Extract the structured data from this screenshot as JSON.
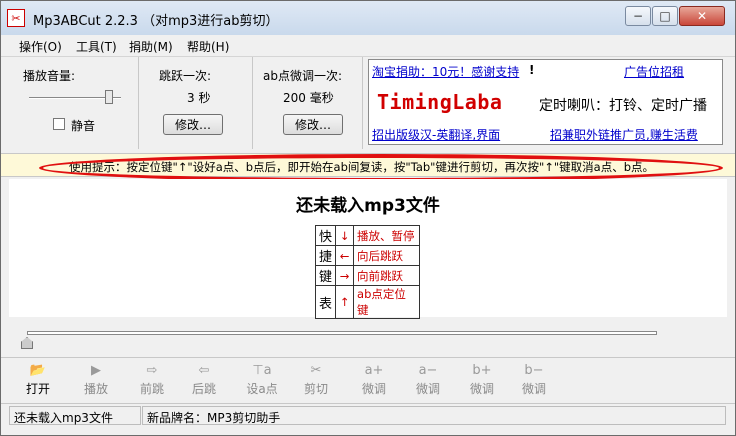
{
  "window": {
    "title": "Mp3ABCut 2.2.3 （对mp3进行ab剪切）",
    "minimize": "−",
    "maximize": "□",
    "close": "✕"
  },
  "menu": [
    "操作(O)",
    "工具(T)",
    "捐助(M)",
    "帮助(H)"
  ],
  "volume": {
    "label": "播放音量:",
    "mute_label": "静音",
    "muted": false
  },
  "jump": {
    "label": "跳跃一次:",
    "value": "3  秒",
    "button": "修改…"
  },
  "ab_adjust": {
    "label": "ab点微调一次:",
    "value": "200  毫秒",
    "button": "修改…"
  },
  "ad": {
    "donate": "淘宝捐助：10元！感谢支持",
    "donate_mark": "!",
    "rent": "广告位招租",
    "brand": "TimingLaba",
    "slogan": "定时喇叭：打铃、定时广播",
    "hire": "招出版级汉-英翻译,界面",
    "agent": "招兼职外链推广员,赚生活费"
  },
  "tip": "使用提示：按定位键\"↑\"设好a点、b点后，即开始在ab间复读，按\"Tab\"键进行剪切，再次按\"↑\"键取消a点、b点。",
  "main": {
    "status": "还未载入mp3文件",
    "shortcut_title": [
      "快",
      "捷",
      "键",
      "表"
    ],
    "shortcuts": [
      {
        "arrow": "↓",
        "desc": "播放、暂停"
      },
      {
        "arrow": "←",
        "desc": "向后跳跃"
      },
      {
        "arrow": "→",
        "desc": "向前跳跃"
      },
      {
        "arrow": "↑",
        "desc": "ab点定位键"
      }
    ]
  },
  "toolbar": [
    {
      "icon": "open-folder-icon",
      "glyph": "📂",
      "label": "打开",
      "enabled": true
    },
    {
      "icon": "play-icon",
      "glyph": "▶",
      "label": "播放",
      "enabled": false
    },
    {
      "icon": "skip-forward-icon",
      "glyph": "⇨",
      "label": "前跳",
      "enabled": false
    },
    {
      "icon": "skip-back-icon",
      "glyph": "⇦",
      "label": "后跳",
      "enabled": false
    },
    {
      "icon": "set-point-icon",
      "glyph": "⊤a",
      "label": "设a点",
      "enabled": false
    },
    {
      "icon": "cut-icon",
      "glyph": "✂",
      "label": "剪切",
      "enabled": false
    },
    {
      "icon": "a-plus-icon",
      "glyph": "a+",
      "label": "微调",
      "enabled": false
    },
    {
      "icon": "a-minus-icon",
      "glyph": "a−",
      "label": "微调",
      "enabled": false
    },
    {
      "icon": "b-plus-icon",
      "glyph": "b+",
      "label": "微调",
      "enabled": false
    },
    {
      "icon": "b-minus-icon",
      "glyph": "b−",
      "label": "微调",
      "enabled": false
    }
  ],
  "statusbar": {
    "left": "还未载入mp3文件",
    "right": "新品牌名：MP3剪切助手"
  }
}
